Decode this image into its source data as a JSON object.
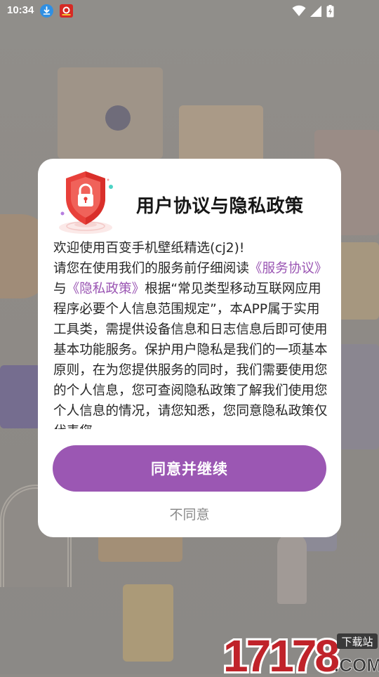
{
  "status_bar": {
    "time": "10:34",
    "icons": [
      "download-notification-icon",
      "app-notification-icon",
      "wifi-icon",
      "cellular-signal-icon",
      "battery-charging-icon"
    ]
  },
  "dialog": {
    "title": "用户协议与隐私政策",
    "greeting": "欢迎使用百变手机壁纸精选(cj2)!",
    "body_prefix": "请您在使用我们的服务前仔细阅读",
    "service_agreement_link": "《服务协议》",
    "conjunction": "与",
    "privacy_policy_link": "《隐私政策》",
    "body_main": "根据“常见类型移动互联网应用程序必要个人信息范围规定”，本APP属于实用工具类，需提供设备信息和日志信息后即可使用基本功能服务。保护用户隐私是我们的一项基本原则，在为您提供服务的同时，我们需要使用您的个人信息，您可查阅隐私政策了解我们使用您个人信息的情况，请您知悉，您同意隐私政策仅代表您",
    "agree_label": "同意并继续",
    "disagree_label": "不同意",
    "icon": "shield-lock-icon"
  },
  "watermark": {
    "number": "17178",
    "tag": "下载站",
    "domain": ".COM"
  },
  "colors": {
    "accent": "#9b57b3",
    "link": "#9a55b3",
    "shield": "#e8403a",
    "watermark": "#c0232a"
  }
}
